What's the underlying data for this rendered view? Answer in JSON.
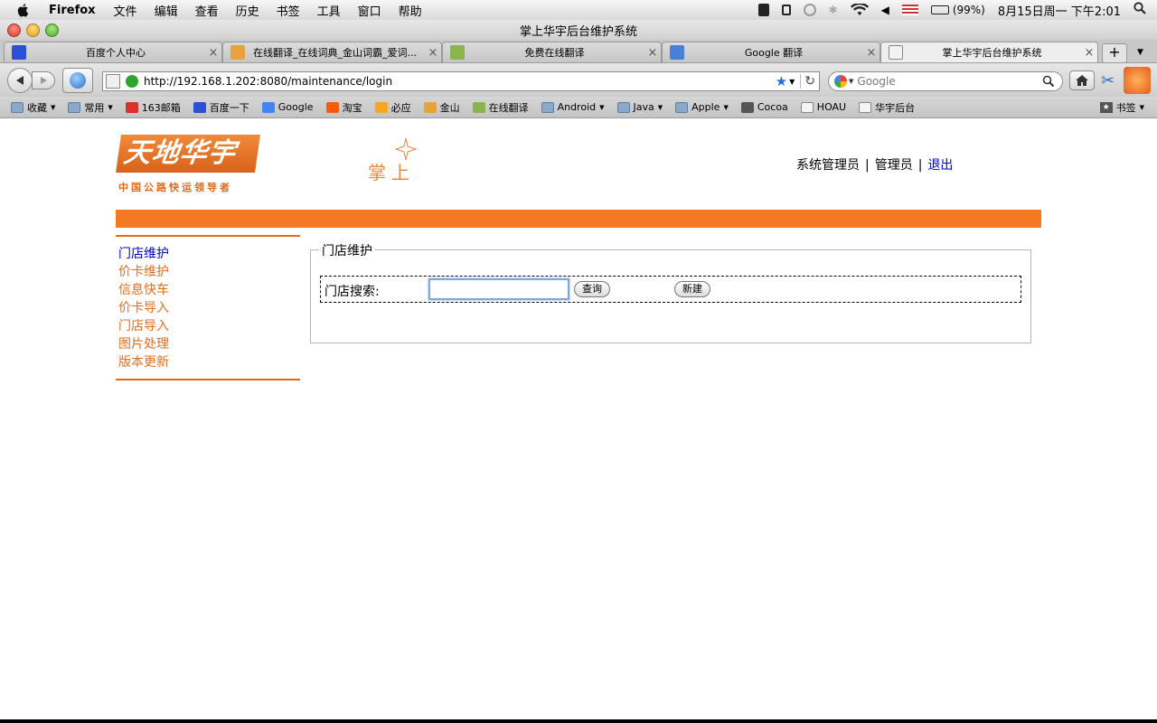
{
  "menubar": {
    "app_name": "Firefox",
    "items": [
      "文件",
      "编辑",
      "查看",
      "历史",
      "书签",
      "工具",
      "窗口",
      "帮助"
    ],
    "battery": "(99%)",
    "datetime": "8月15日周一 下午2:01"
  },
  "window": {
    "title": "掌上华宇后台维护系统"
  },
  "tabs": [
    {
      "label": "百度个人中心",
      "active": false
    },
    {
      "label": "在线翻译_在线词典_金山词霸_爱词...",
      "active": false
    },
    {
      "label": "免费在线翻译",
      "active": false
    },
    {
      "label": "Google 翻译",
      "active": false
    },
    {
      "label": "掌上华宇后台维护系统",
      "active": true
    }
  ],
  "tab_close_glyph": "×",
  "new_tab_glyph": "+",
  "navbar": {
    "url": "http://192.168.1.202:8080/maintenance/login",
    "search_placeholder": "Google"
  },
  "bookmarks": [
    {
      "label": "收藏",
      "icon": "folder-icon",
      "menu": true
    },
    {
      "label": "常用",
      "icon": "folder-icon",
      "menu": true
    },
    {
      "label": "163邮箱",
      "icon": "mail163-icon",
      "menu": false
    },
    {
      "label": "百度一下",
      "icon": "baidu-icon",
      "menu": false
    },
    {
      "label": "Google",
      "icon": "google-icon",
      "menu": false
    },
    {
      "label": "淘宝",
      "icon": "taobao-icon",
      "menu": false
    },
    {
      "label": "必应",
      "icon": "bing-icon",
      "menu": false
    },
    {
      "label": "金山",
      "icon": "iciba-icon",
      "menu": false
    },
    {
      "label": "在线翻译",
      "icon": "hao123-icon",
      "menu": false
    },
    {
      "label": "Android",
      "icon": "folder-icon",
      "menu": true
    },
    {
      "label": "Java",
      "icon": "folder-icon",
      "menu": true
    },
    {
      "label": "Apple",
      "icon": "folder-icon",
      "menu": true
    },
    {
      "label": "Cocoa",
      "icon": "cocoa-icon",
      "menu": false
    },
    {
      "label": "HOAU",
      "icon": "page-icon",
      "menu": false
    },
    {
      "label": "华宇后台",
      "icon": "page-icon",
      "menu": false
    }
  ],
  "bookmarks_menu": "书签",
  "page": {
    "logo_text": "天地华宇",
    "logo_tagline": "中国公路快运领导者",
    "logo_zhangshang": "掌上",
    "user": {
      "role": "系统管理员",
      "name": "管理员",
      "logout": "退出",
      "separator": "|"
    },
    "sidebar": [
      {
        "label": "门店维护",
        "active": true
      },
      {
        "label": "价卡维护",
        "active": false
      },
      {
        "label": "信息快车",
        "active": false
      },
      {
        "label": "价卡导入",
        "active": false
      },
      {
        "label": "门店导入",
        "active": false
      },
      {
        "label": "图片处理",
        "active": false
      },
      {
        "label": "版本更新",
        "active": false
      }
    ],
    "panel": {
      "legend": "门店维护",
      "search_label": "门店搜索:",
      "search_value": "",
      "query_button": "查询",
      "new_button": "新建"
    }
  },
  "colors": {
    "accent_orange": "#f57923",
    "nav_text": "#e46d1e",
    "link_blue": "#0000cc"
  }
}
